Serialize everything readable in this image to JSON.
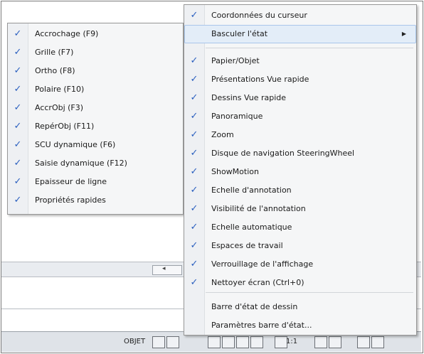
{
  "submenu": {
    "items": [
      {
        "label": "Accrochage (F9)",
        "checked": true
      },
      {
        "label": "Grille (F7)",
        "checked": true
      },
      {
        "label": "Ortho (F8)",
        "checked": true
      },
      {
        "label": "Polaire (F10)",
        "checked": true
      },
      {
        "label": "AccrObj (F3)",
        "checked": true
      },
      {
        "label": "RepérObj (F11)",
        "checked": true
      },
      {
        "label": "SCU dynamique (F6)",
        "checked": true
      },
      {
        "label": "Saisie dynamique (F12)",
        "checked": true
      },
      {
        "label": "Epaisseur de ligne",
        "checked": true
      },
      {
        "label": "Propriétés rapides",
        "checked": true
      }
    ]
  },
  "context_menu": {
    "items": [
      {
        "label": "Coordonnées du curseur",
        "checked": true
      },
      {
        "label": "Basculer l'état",
        "checked": false,
        "submenu": true,
        "highlighted": true
      },
      {
        "label": "Papier/Objet",
        "checked": true
      },
      {
        "label": "Présentations Vue rapide",
        "checked": true
      },
      {
        "label": "Dessins Vue rapide",
        "checked": true
      },
      {
        "label": "Panoramique",
        "checked": true
      },
      {
        "label": "Zoom",
        "checked": true
      },
      {
        "label": "Disque de navigation SteeringWheel",
        "checked": true
      },
      {
        "label": "ShowMotion",
        "checked": true
      },
      {
        "label": "Echelle d'annotation",
        "checked": true
      },
      {
        "label": "Visibilité de l'annotation",
        "checked": true
      },
      {
        "label": "Echelle automatique",
        "checked": true
      },
      {
        "label": "Espaces de travail",
        "checked": true
      },
      {
        "label": "Verrouillage de l'affichage",
        "checked": true
      },
      {
        "label": "Nettoyer écran (Ctrl+0)",
        "checked": true
      },
      {
        "label": "Barre d'état de dessin",
        "checked": false
      },
      {
        "label": "Paramètres barre d'état...",
        "checked": false
      }
    ]
  },
  "statusbar": {
    "objet_label": "OBJET",
    "scale_label": "1:1"
  },
  "glyphs": {
    "check": "✓",
    "submenu_arrow": "▶"
  },
  "colors": {
    "check": "#2a5fbf",
    "highlight": "#e3edf8"
  }
}
